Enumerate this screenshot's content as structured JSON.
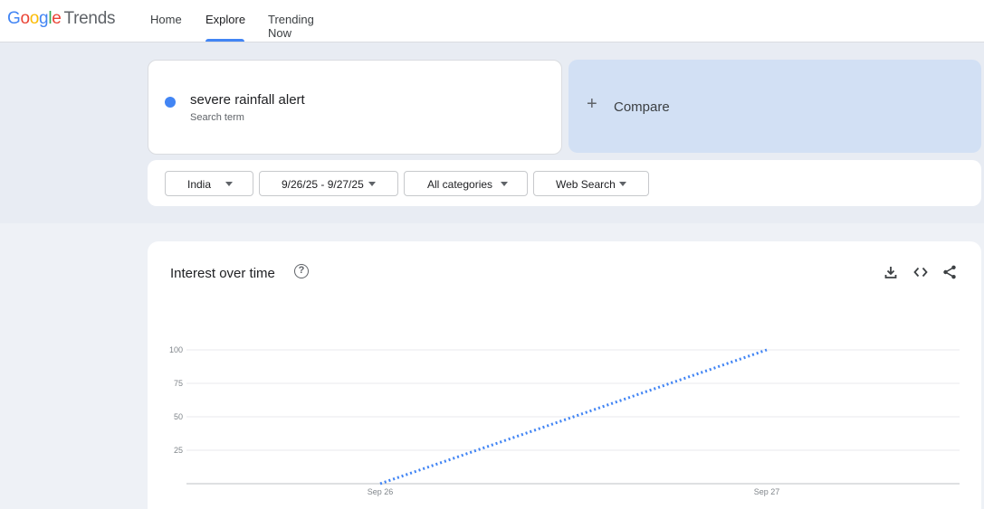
{
  "header": {
    "logo_google": [
      "G",
      "o",
      "o",
      "g",
      "l",
      "e"
    ],
    "logo_trends": "Trends",
    "tabs": [
      {
        "label": "Home",
        "active": false
      },
      {
        "label": "Explore",
        "active": true
      },
      {
        "label": "Trending Now",
        "active": false
      }
    ]
  },
  "search": {
    "term": "severe rainfall alert",
    "term_type": "Search term",
    "term_color": "#4285f4",
    "compare_icon": "plus-icon",
    "compare_label": "Compare"
  },
  "filters": [
    {
      "label": "India"
    },
    {
      "label": "9/26/25 - 9/27/25"
    },
    {
      "label": "All categories"
    },
    {
      "label": "Web Search"
    }
  ],
  "chart_section": {
    "title": "Interest over time",
    "help_icon": "help-circle-icon",
    "tools": [
      "download-icon",
      "embed-code-icon",
      "share-icon"
    ]
  },
  "chart_data": {
    "type": "line",
    "x": [
      "Sep 26",
      "Sep 27"
    ],
    "series": [
      {
        "values": [
          0,
          100
        ],
        "color": "#4285f4",
        "style": "dotted"
      }
    ],
    "yticks": [
      25,
      50,
      75,
      100
    ],
    "ylim": [
      0,
      100
    ],
    "grid": true,
    "legend": "none"
  }
}
